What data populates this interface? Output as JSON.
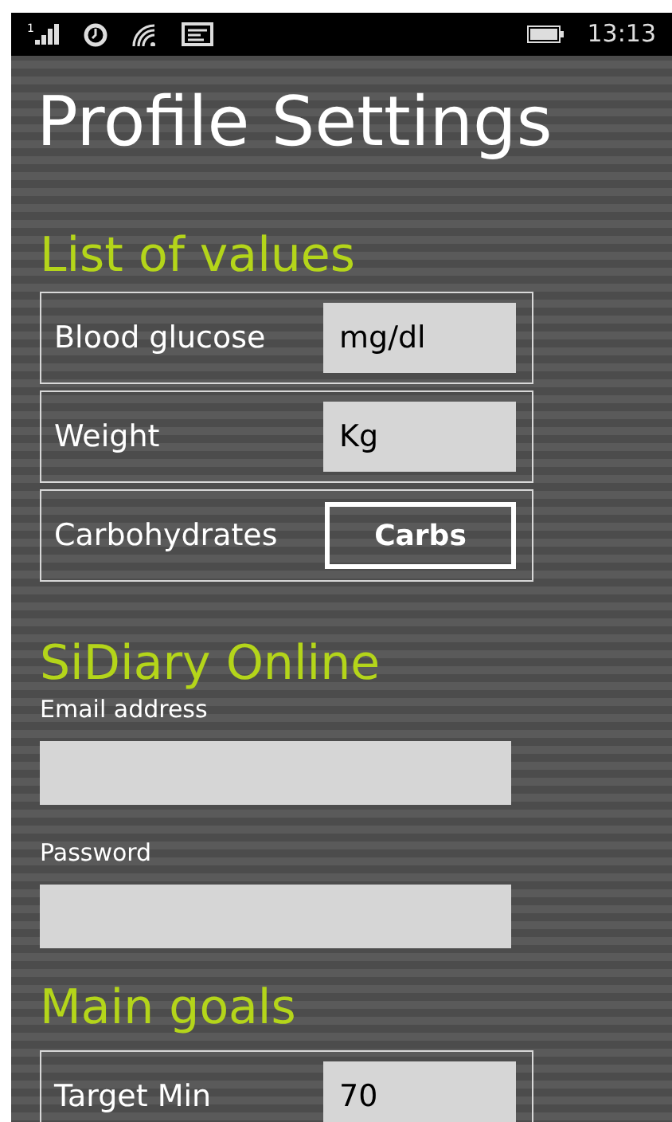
{
  "status_bar": {
    "sim_slot": "1",
    "time": "13:13"
  },
  "title": "Profile Settings",
  "units_section": {
    "heading": "List of values",
    "rows": [
      {
        "kind": "field",
        "label": "Blood glucose",
        "value": "mg/dl"
      },
      {
        "kind": "field",
        "label": "Weight",
        "value": "Kg"
      },
      {
        "kind": "button",
        "label": "Carbohydrates",
        "value": "Carbs"
      }
    ]
  },
  "online_section": {
    "heading": "SiDiary Online",
    "fields": [
      {
        "label": "Email address"
      },
      {
        "label": "Password"
      }
    ]
  },
  "goals_section": {
    "heading": "Main goals",
    "rows": [
      {
        "kind": "field",
        "label": "Target Min",
        "value": "70"
      }
    ]
  }
}
